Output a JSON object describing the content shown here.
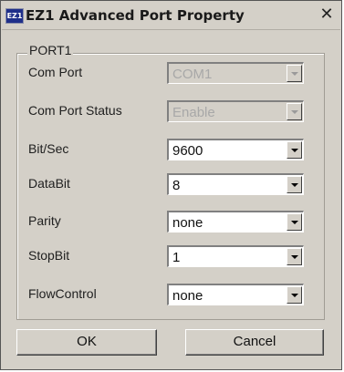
{
  "window": {
    "icon_text": "EZ1",
    "title": "EZ1 Advanced Port Property",
    "close_glyph": "✕"
  },
  "group": {
    "label": "PORT1"
  },
  "fields": [
    {
      "label": "Com Port",
      "value": "COM1",
      "enabled": false
    },
    {
      "label": "Com Port Status",
      "value": "Enable",
      "enabled": false
    },
    {
      "label": "Bit/Sec",
      "value": "9600",
      "enabled": true
    },
    {
      "label": "DataBit",
      "value": "8",
      "enabled": true
    },
    {
      "label": "Parity",
      "value": "none",
      "enabled": true
    },
    {
      "label": "StopBit",
      "value": "1",
      "enabled": true
    },
    {
      "label": "FlowControl",
      "value": "none",
      "enabled": true
    }
  ],
  "buttons": {
    "ok": "OK",
    "cancel": "Cancel"
  },
  "icons": [
    "app-icon",
    "close-icon",
    "chevron-down-icon"
  ]
}
